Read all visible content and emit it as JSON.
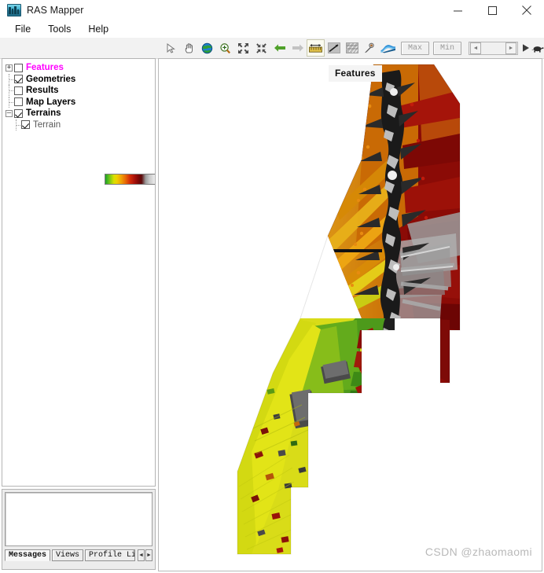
{
  "window": {
    "title": "RAS Mapper",
    "icon": "ras-mapper-icon",
    "controls": {
      "minimize": "minimize-icon",
      "maximize": "maximize-icon",
      "close": "close-icon"
    }
  },
  "menu": {
    "items": [
      {
        "label": "File"
      },
      {
        "label": "Tools"
      },
      {
        "label": "Help"
      }
    ]
  },
  "toolbar": {
    "tools": [
      {
        "name": "select-arrow-icon",
        "title": "Select",
        "state": "normal"
      },
      {
        "name": "pan-hand-icon",
        "title": "Pan",
        "state": "normal"
      },
      {
        "name": "globe-icon",
        "title": "Full Extent",
        "state": "normal"
      },
      {
        "name": "zoom-in-icon",
        "title": "Zoom In",
        "state": "normal"
      },
      {
        "name": "zoom-to-extent-icon",
        "title": "Zoom To Extent",
        "state": "normal"
      },
      {
        "name": "zoom-out-icon",
        "title": "Zoom Out",
        "state": "normal"
      },
      {
        "name": "back-arrow-icon",
        "title": "Previous Extent",
        "state": "enabled"
      },
      {
        "name": "forward-arrow-icon",
        "title": "Next Extent",
        "state": "disabled"
      },
      {
        "name": "measure-ruler-icon",
        "title": "Measure",
        "state": "active"
      },
      {
        "name": "profile-line-icon",
        "title": "Profile Line",
        "state": "normal"
      },
      {
        "name": "hatch-grid-icon",
        "title": "Grid",
        "state": "normal"
      },
      {
        "name": "stamp-tool-icon",
        "title": "Stamp Terrain",
        "state": "normal"
      },
      {
        "name": "water-surface-icon",
        "title": "Water Surface",
        "state": "normal"
      }
    ],
    "max_button": "Max",
    "min_button": "Min",
    "slider_left_arrow": "◄",
    "slider_right_arrow": "►",
    "play_button": "play-icon",
    "speed_button": "turtle-icon"
  },
  "tree": {
    "nodes": [
      {
        "label": "Features",
        "checked": false,
        "expander": "+",
        "style": "magenta",
        "level": 0
      },
      {
        "label": "Geometries",
        "checked": true,
        "expander": "",
        "style": "bold",
        "level": 0
      },
      {
        "label": "Results",
        "checked": false,
        "expander": "",
        "style": "bold",
        "level": 0
      },
      {
        "label": "Map Layers",
        "checked": false,
        "expander": "",
        "style": "bold",
        "level": 0
      },
      {
        "label": "Terrains",
        "checked": true,
        "expander": "–",
        "style": "bold",
        "level": 0
      },
      {
        "label": "Terrain",
        "checked": true,
        "expander": "",
        "style": "child",
        "level": 1
      }
    ],
    "legend": {
      "name": "terrain-colorbar",
      "stops": [
        "#1ea02a",
        "#d8e000",
        "#f0d000",
        "#e86a05",
        "#d32b09",
        "#7c0606",
        "#9b9b9b",
        "#f2f2f2"
      ]
    }
  },
  "bottom_panel": {
    "message_text": "",
    "tabs": [
      {
        "label": "Messages",
        "active": true
      },
      {
        "label": "Views",
        "active": false
      },
      {
        "label": "Profile Line",
        "active": false
      }
    ],
    "scroll_left": "◄",
    "scroll_right": "►"
  },
  "map": {
    "overlay_label": "Features",
    "watermark": "CSDN @zhaomaomi",
    "layer_name": "terrain-raster"
  }
}
